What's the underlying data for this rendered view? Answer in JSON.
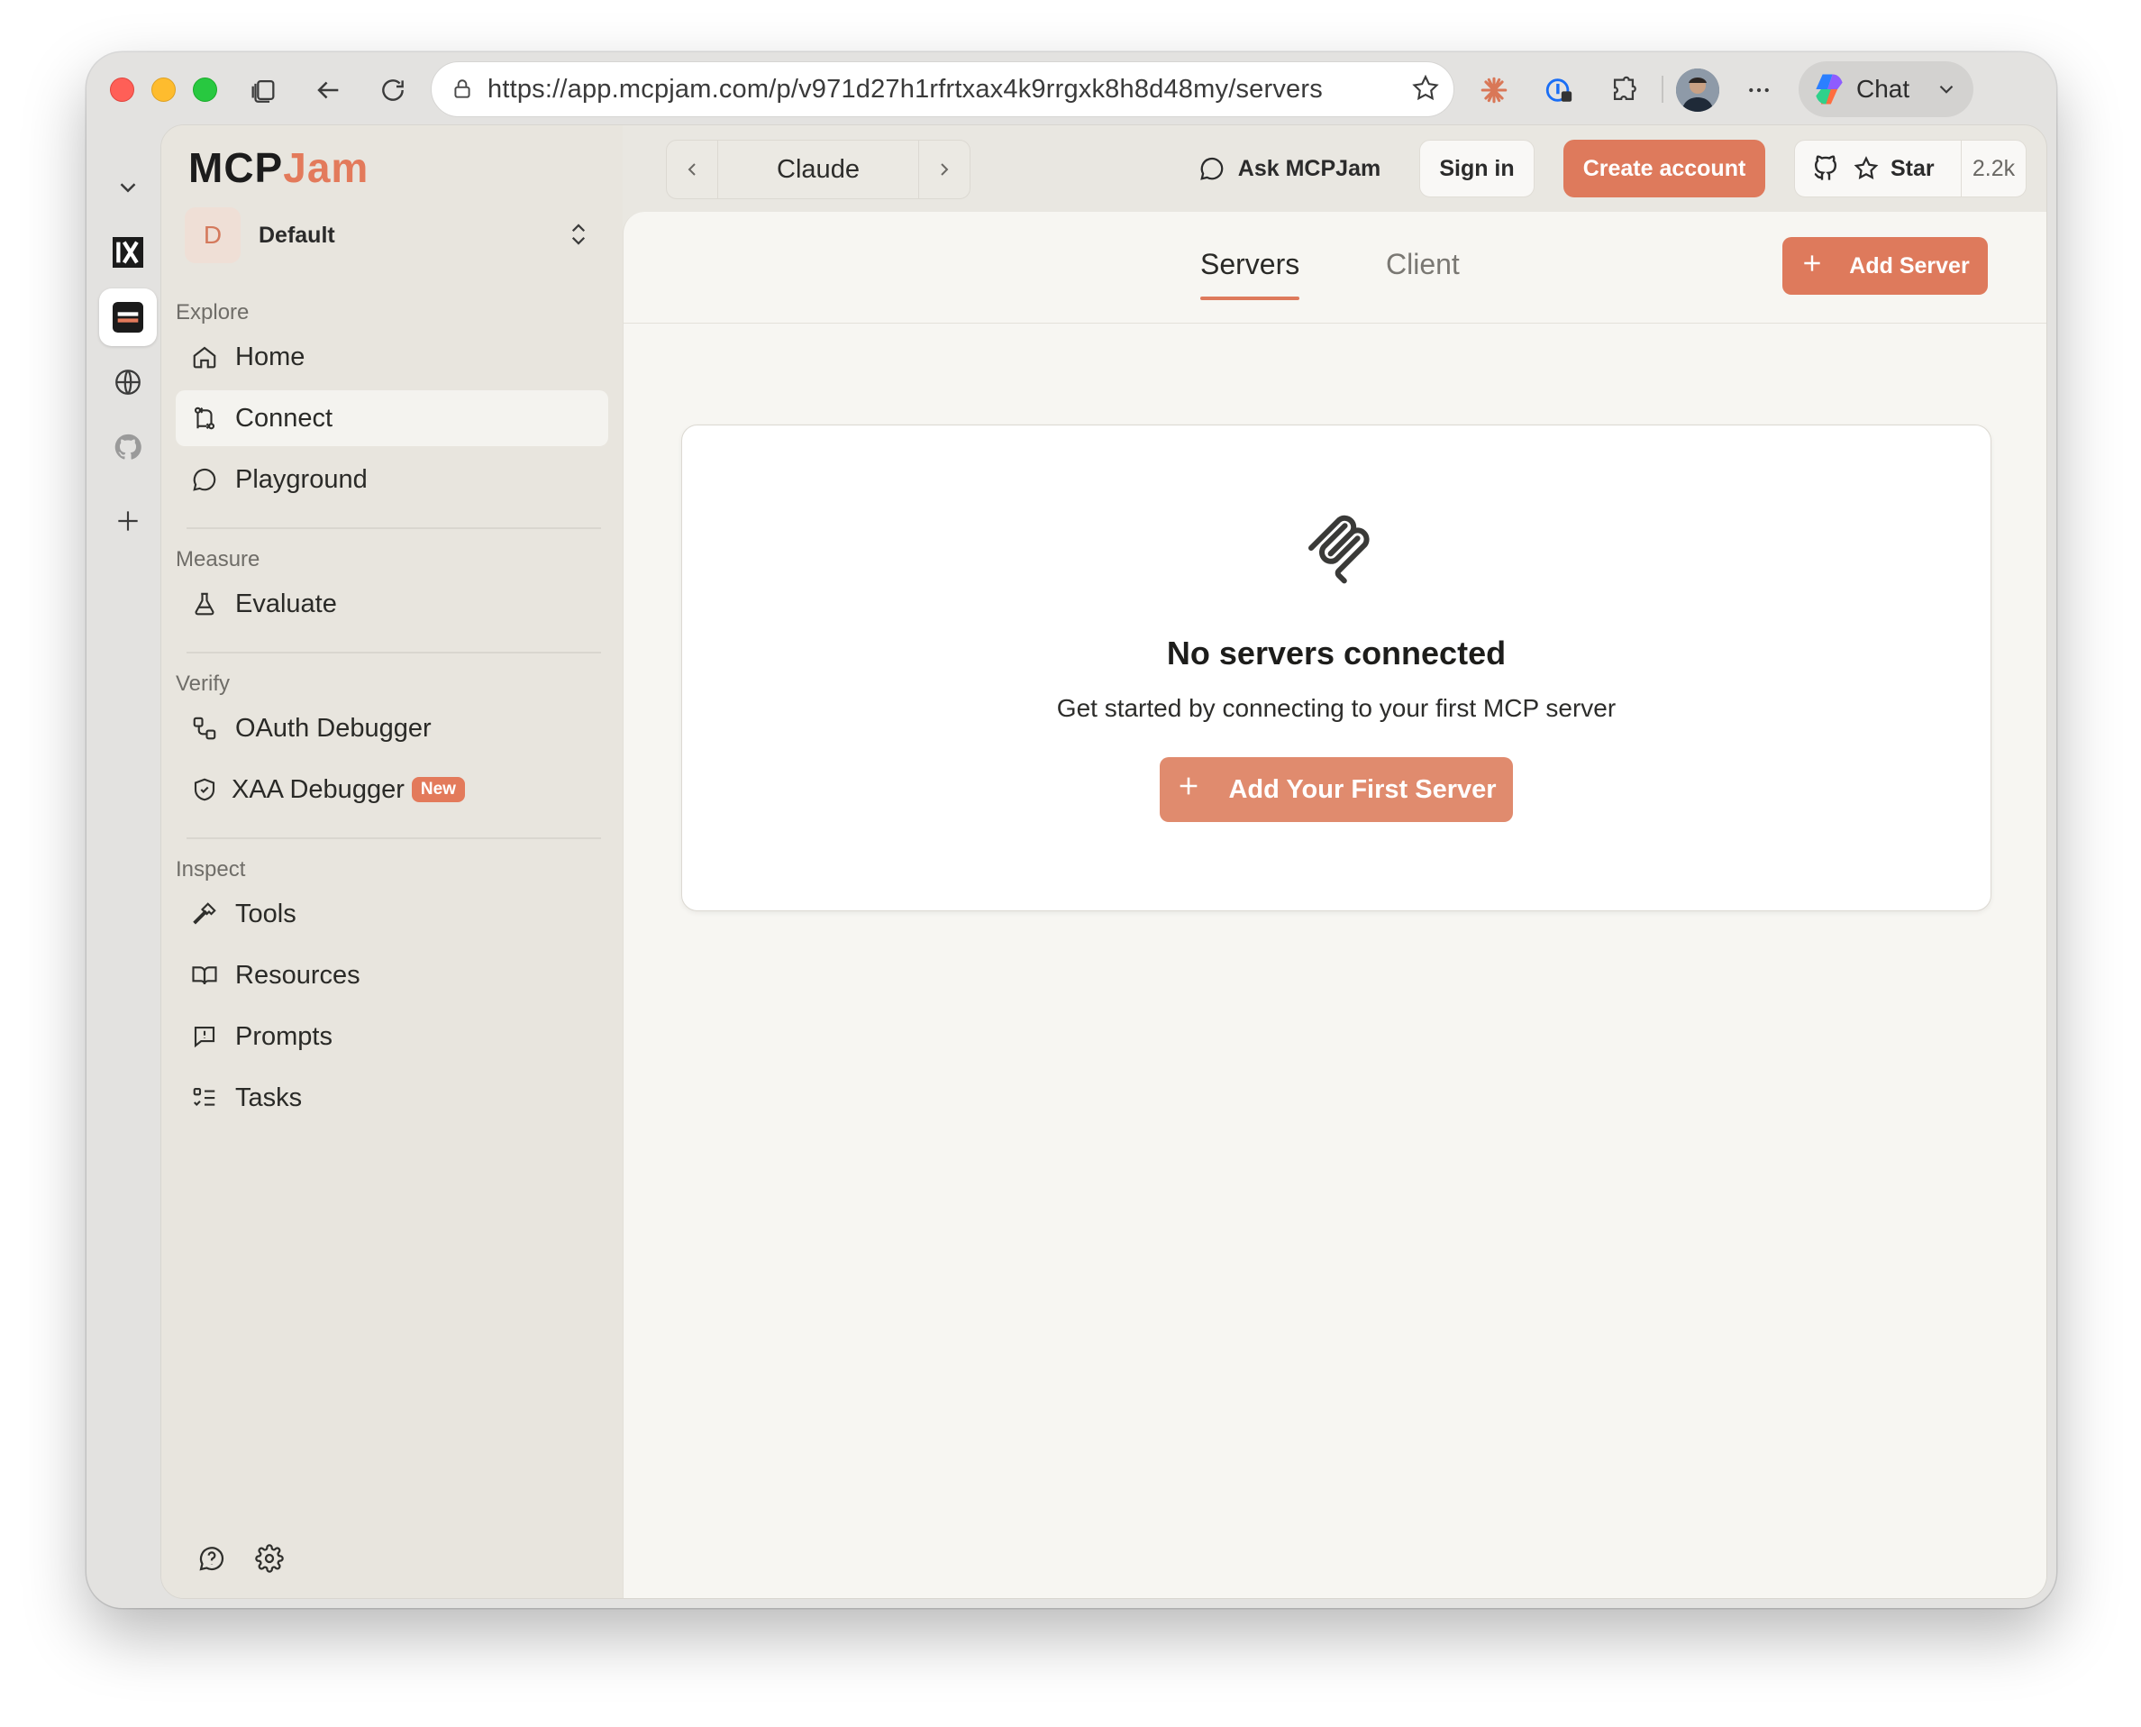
{
  "browser": {
    "url": "https://app.mcpjam.com/p/v971d27h1rfrtxax4k9rrgxk8h8d48my/servers",
    "chat_label": "Chat"
  },
  "app": {
    "logo_part1": "MCP",
    "logo_part2": "Jam",
    "workspace": {
      "initial": "D",
      "name": "Default"
    }
  },
  "sidebar": {
    "sections": [
      {
        "label": "Explore",
        "items": [
          {
            "label": "Home",
            "icon": "home-icon"
          },
          {
            "label": "Connect",
            "icon": "connect-icon",
            "active": true
          },
          {
            "label": "Playground",
            "icon": "chat-bubble-icon"
          }
        ]
      },
      {
        "label": "Measure",
        "items": [
          {
            "label": "Evaluate",
            "icon": "flask-icon"
          }
        ]
      },
      {
        "label": "Verify",
        "items": [
          {
            "label": "OAuth Debugger",
            "icon": "workflow-icon"
          },
          {
            "label": "XAA Debugger",
            "icon": "shield-check-icon",
            "badge": "New"
          }
        ]
      },
      {
        "label": "Inspect",
        "items": [
          {
            "label": "Tools",
            "icon": "hammer-icon"
          },
          {
            "label": "Resources",
            "icon": "book-icon"
          },
          {
            "label": "Prompts",
            "icon": "message-square-icon"
          },
          {
            "label": "Tasks",
            "icon": "list-todo-icon"
          }
        ]
      }
    ]
  },
  "header": {
    "client_name": "Claude",
    "ask_label": "Ask MCPJam",
    "signin_label": "Sign in",
    "create_label": "Create account",
    "star_label": "Star",
    "star_count": "2.2k"
  },
  "main": {
    "tabs": {
      "servers": "Servers",
      "client": "Client"
    },
    "add_server_label": "Add Server",
    "empty": {
      "title": "No servers connected",
      "subtitle": "Get started by connecting to your first MCP server",
      "button_label": "Add Your First Server"
    }
  },
  "colors": {
    "accent": "#de7a5c",
    "sidebar_bg": "#e8e5de",
    "main_bg": "#f7f6f2"
  }
}
